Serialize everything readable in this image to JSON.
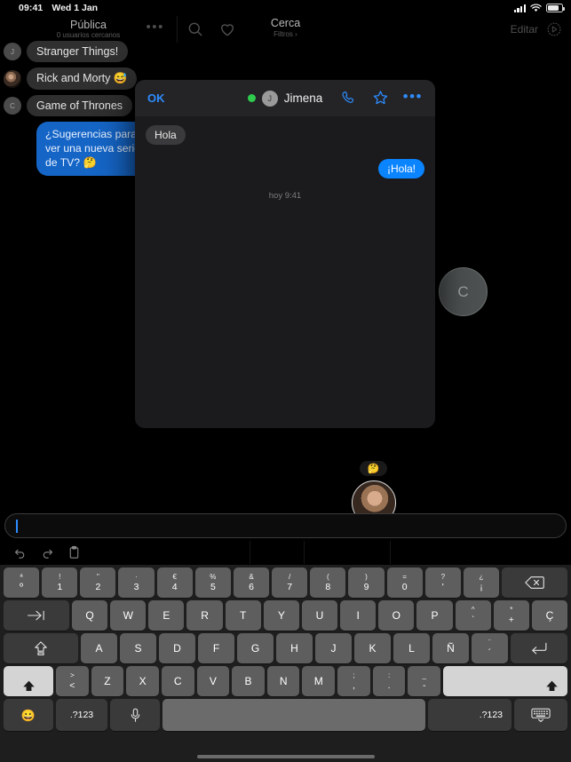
{
  "statusbar": {
    "time": "09:41",
    "date": "Wed 1 Jan",
    "signal_icon": "cellular-bars-icon",
    "wifi_icon": "wifi-icon",
    "battery_icon": "battery-icon"
  },
  "topnav": {
    "left_title": "Pública",
    "left_subtitle": "0 usuarios cercanos",
    "more_label": "•••",
    "search_icon": "search-icon",
    "heart_icon": "heart-icon",
    "center_title": "Cerca",
    "center_subtitle": "Filtros ›",
    "edit_label": "Editar",
    "share_icon": "share-circle-icon"
  },
  "chatlist": [
    {
      "avatar": "J",
      "avatar_type": "initial",
      "text": "Stranger Things!"
    },
    {
      "avatar": "",
      "avatar_type": "photo",
      "text": "Rick and Morty 😅"
    },
    {
      "avatar": "C",
      "avatar_type": "initial",
      "text": "Game of Thrones"
    }
  ],
  "outgoing_message": "¿Sugerencias para ver una nueva serie de TV? 🤔",
  "floating": {
    "avatar_c": "C",
    "emoji_badge": "🤔"
  },
  "modal": {
    "ok_label": "OK",
    "status_dot_color": "#2ecb4f",
    "avatar_initial": "J",
    "contact_name": "Jimena",
    "call_icon": "phone-icon",
    "star_icon": "star-icon",
    "more_icon": "more-dots-icon",
    "messages": [
      {
        "side": "in",
        "text": "Hola"
      },
      {
        "side": "out",
        "text": "¡Hola!"
      }
    ],
    "timestamp": "hoy 9:41"
  },
  "compose": {
    "value": "",
    "placeholder": ""
  },
  "edit_toolbar": {
    "undo_icon": "undo-icon",
    "redo_icon": "redo-icon",
    "paste_icon": "paste-icon"
  },
  "keyboard": {
    "row1": [
      {
        "top": "ª",
        "bot": "º"
      },
      {
        "top": "!",
        "bot": "1"
      },
      {
        "top": "\"",
        "bot": "2"
      },
      {
        "top": "·",
        "bot": "3"
      },
      {
        "top": "€",
        "bot": "4"
      },
      {
        "top": "%",
        "bot": "5"
      },
      {
        "top": "&",
        "bot": "6"
      },
      {
        "top": "/",
        "bot": "7"
      },
      {
        "top": "(",
        "bot": "8"
      },
      {
        "top": ")",
        "bot": "9"
      },
      {
        "top": "=",
        "bot": "0"
      },
      {
        "top": "?",
        "bot": "'"
      },
      {
        "top": "¿",
        "bot": "¡"
      }
    ],
    "backspace_icon": "backspace-icon",
    "tab_icon": "tab-icon",
    "row2": [
      "Q",
      "W",
      "E",
      "R",
      "T",
      "Y",
      "U",
      "I",
      "O",
      "P"
    ],
    "row2_extra": [
      {
        "top": "^",
        "bot": "`"
      },
      {
        "top": "*",
        "bot": "+"
      }
    ],
    "row2_cedilla": "Ç",
    "capslock_icon": "capslock-icon",
    "row3": [
      "A",
      "S",
      "D",
      "F",
      "G",
      "H",
      "J",
      "K",
      "L",
      "Ñ"
    ],
    "row3_extra": [
      {
        "top": "¨",
        "bot": "´"
      }
    ],
    "enter_icon": "enter-icon",
    "shift_left_icon": "shift-icon",
    "row4_angle": {
      "top": ">",
      "bot": "<"
    },
    "row4": [
      "Z",
      "X",
      "C",
      "V",
      "B",
      "N",
      "M"
    ],
    "row4_extra": [
      {
        "top": ";",
        "bot": ","
      },
      {
        "top": ":",
        "bot": "."
      },
      {
        "top": "_",
        "bot": "-"
      }
    ],
    "shift_right_icon": "shift-icon",
    "emoji_key": "😀",
    "num_key_left": ".?123",
    "mic_icon": "microphone-icon",
    "space_key": "",
    "num_key_right": ".?123",
    "hide_keyboard_icon": "hide-keyboard-icon"
  }
}
